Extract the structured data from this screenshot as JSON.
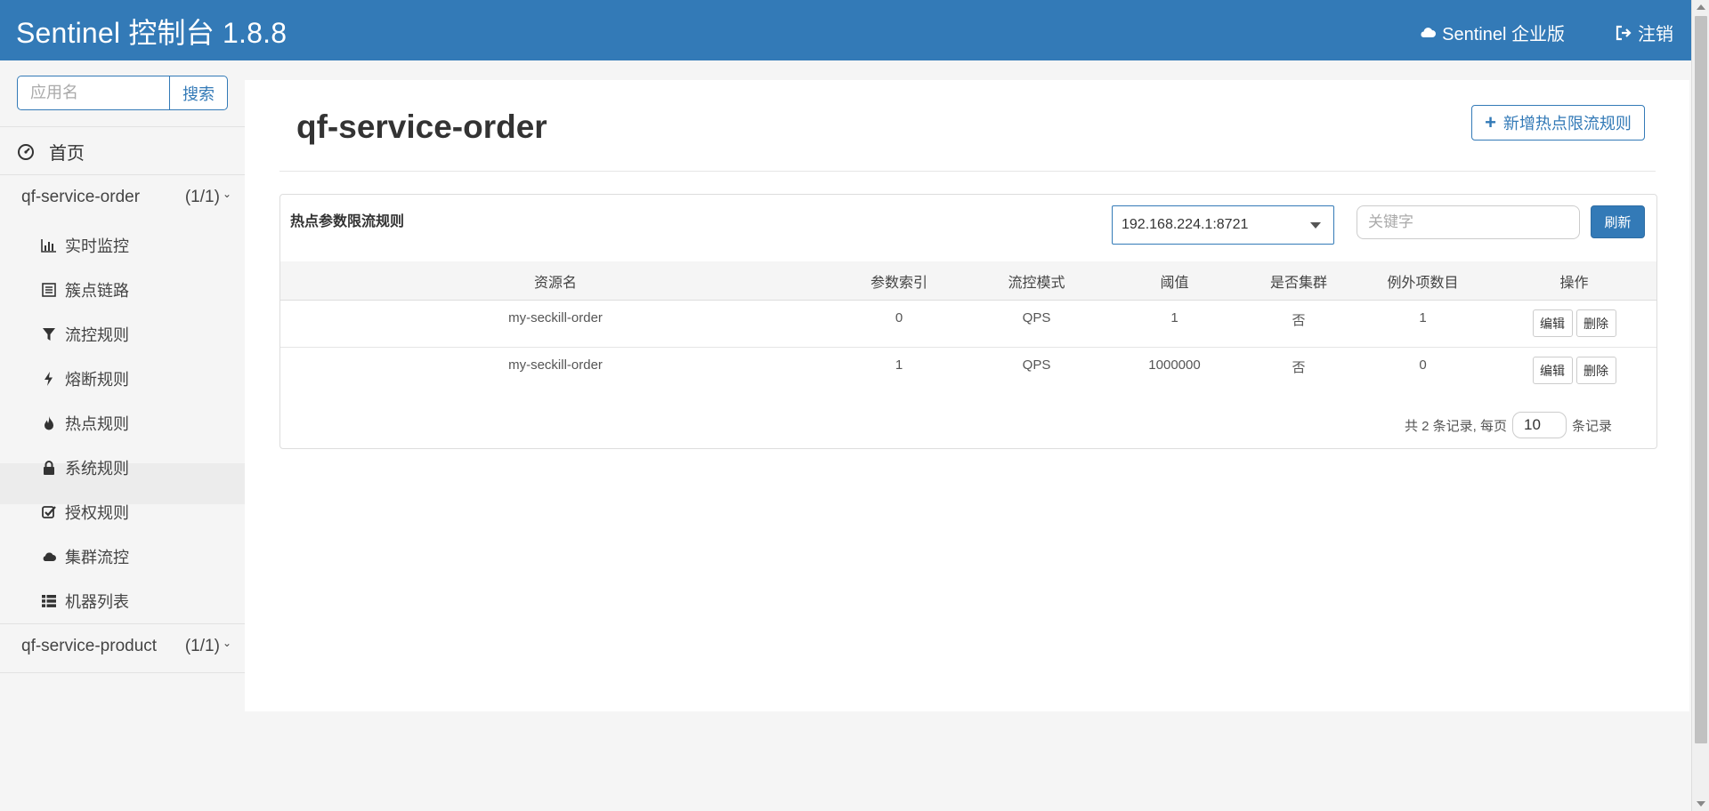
{
  "header": {
    "title": "Sentinel 控制台 1.8.8",
    "enterprise_label": "Sentinel 企业版",
    "logout_label": "注销"
  },
  "sidebar": {
    "search_placeholder": "应用名",
    "search_button": "搜索",
    "home_label": "首页",
    "apps": [
      {
        "name": "qf-service-order",
        "count": "(1/1)",
        "items": [
          {
            "label": "实时监控",
            "icon": "bar-chart-icon"
          },
          {
            "label": "簇点链路",
            "icon": "list-alt-icon"
          },
          {
            "label": "流控规则",
            "icon": "filter-icon"
          },
          {
            "label": "熔断规则",
            "icon": "flash-icon"
          },
          {
            "label": "热点规则",
            "icon": "fire-icon"
          },
          {
            "label": "系统规则",
            "icon": "lock-icon"
          },
          {
            "label": "授权规则",
            "icon": "check-icon"
          },
          {
            "label": "集群流控",
            "icon": "cloud-icon"
          },
          {
            "label": "机器列表",
            "icon": "th-list-icon"
          }
        ]
      },
      {
        "name": "qf-service-product",
        "count": "(1/1)"
      }
    ]
  },
  "main": {
    "title": "qf-service-order",
    "add_button": "新增热点限流规则",
    "panel_title": "热点参数限流规则",
    "machine": "192.168.224.1:8721",
    "keyword_placeholder": "关键字",
    "refresh_button": "刷新",
    "columns": [
      "资源名",
      "参数索引",
      "流控模式",
      "阈值",
      "是否集群",
      "例外项数目",
      "操作"
    ],
    "rows": [
      {
        "resource": "my-seckill-order",
        "index": "0",
        "mode": "QPS",
        "threshold": "1",
        "cluster": "否",
        "exceptions": "1"
      },
      {
        "resource": "my-seckill-order",
        "index": "1",
        "mode": "QPS",
        "threshold": "1000000",
        "cluster": "否",
        "exceptions": "0"
      }
    ],
    "edit_label": "编辑",
    "delete_label": "删除",
    "pager_prefix": "共 2 条记录, 每页",
    "page_size": "10",
    "pager_suffix": "条记录"
  },
  "colors": {
    "primary": "#337ab7",
    "background": "#f5f5f5"
  }
}
